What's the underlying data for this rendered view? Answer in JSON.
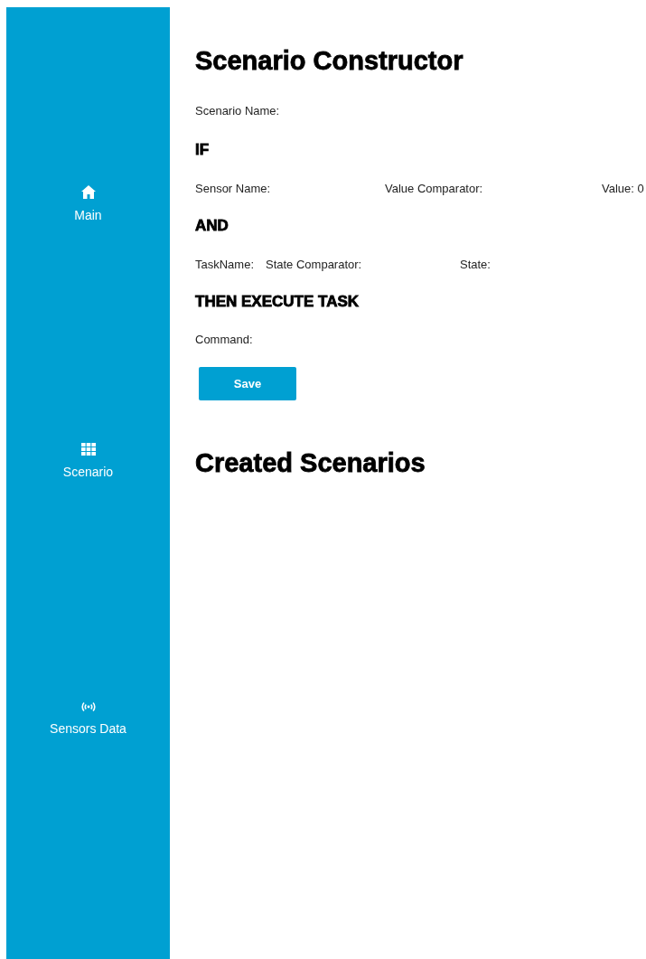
{
  "sidebar": {
    "items": [
      {
        "kind": "home",
        "label": "Main"
      },
      {
        "kind": "grid",
        "label": "Scenario"
      },
      {
        "kind": "signal",
        "label": "Sensors Data"
      }
    ]
  },
  "title": "Scenario Constructor",
  "scenario_name_label": "Scenario Name:",
  "if_heading": "IF",
  "if_fields": [
    "Sensor Name:",
    "Value Comparator:",
    "Value: 0"
  ],
  "and_heading": "AND",
  "and_fields": [
    "TaskName:",
    "State Comparator:",
    "State:"
  ],
  "then_heading": "THEN EXECUTE TASK",
  "command_label": "Command:",
  "save_button": "Save",
  "created_heading": "Created Scenarios"
}
